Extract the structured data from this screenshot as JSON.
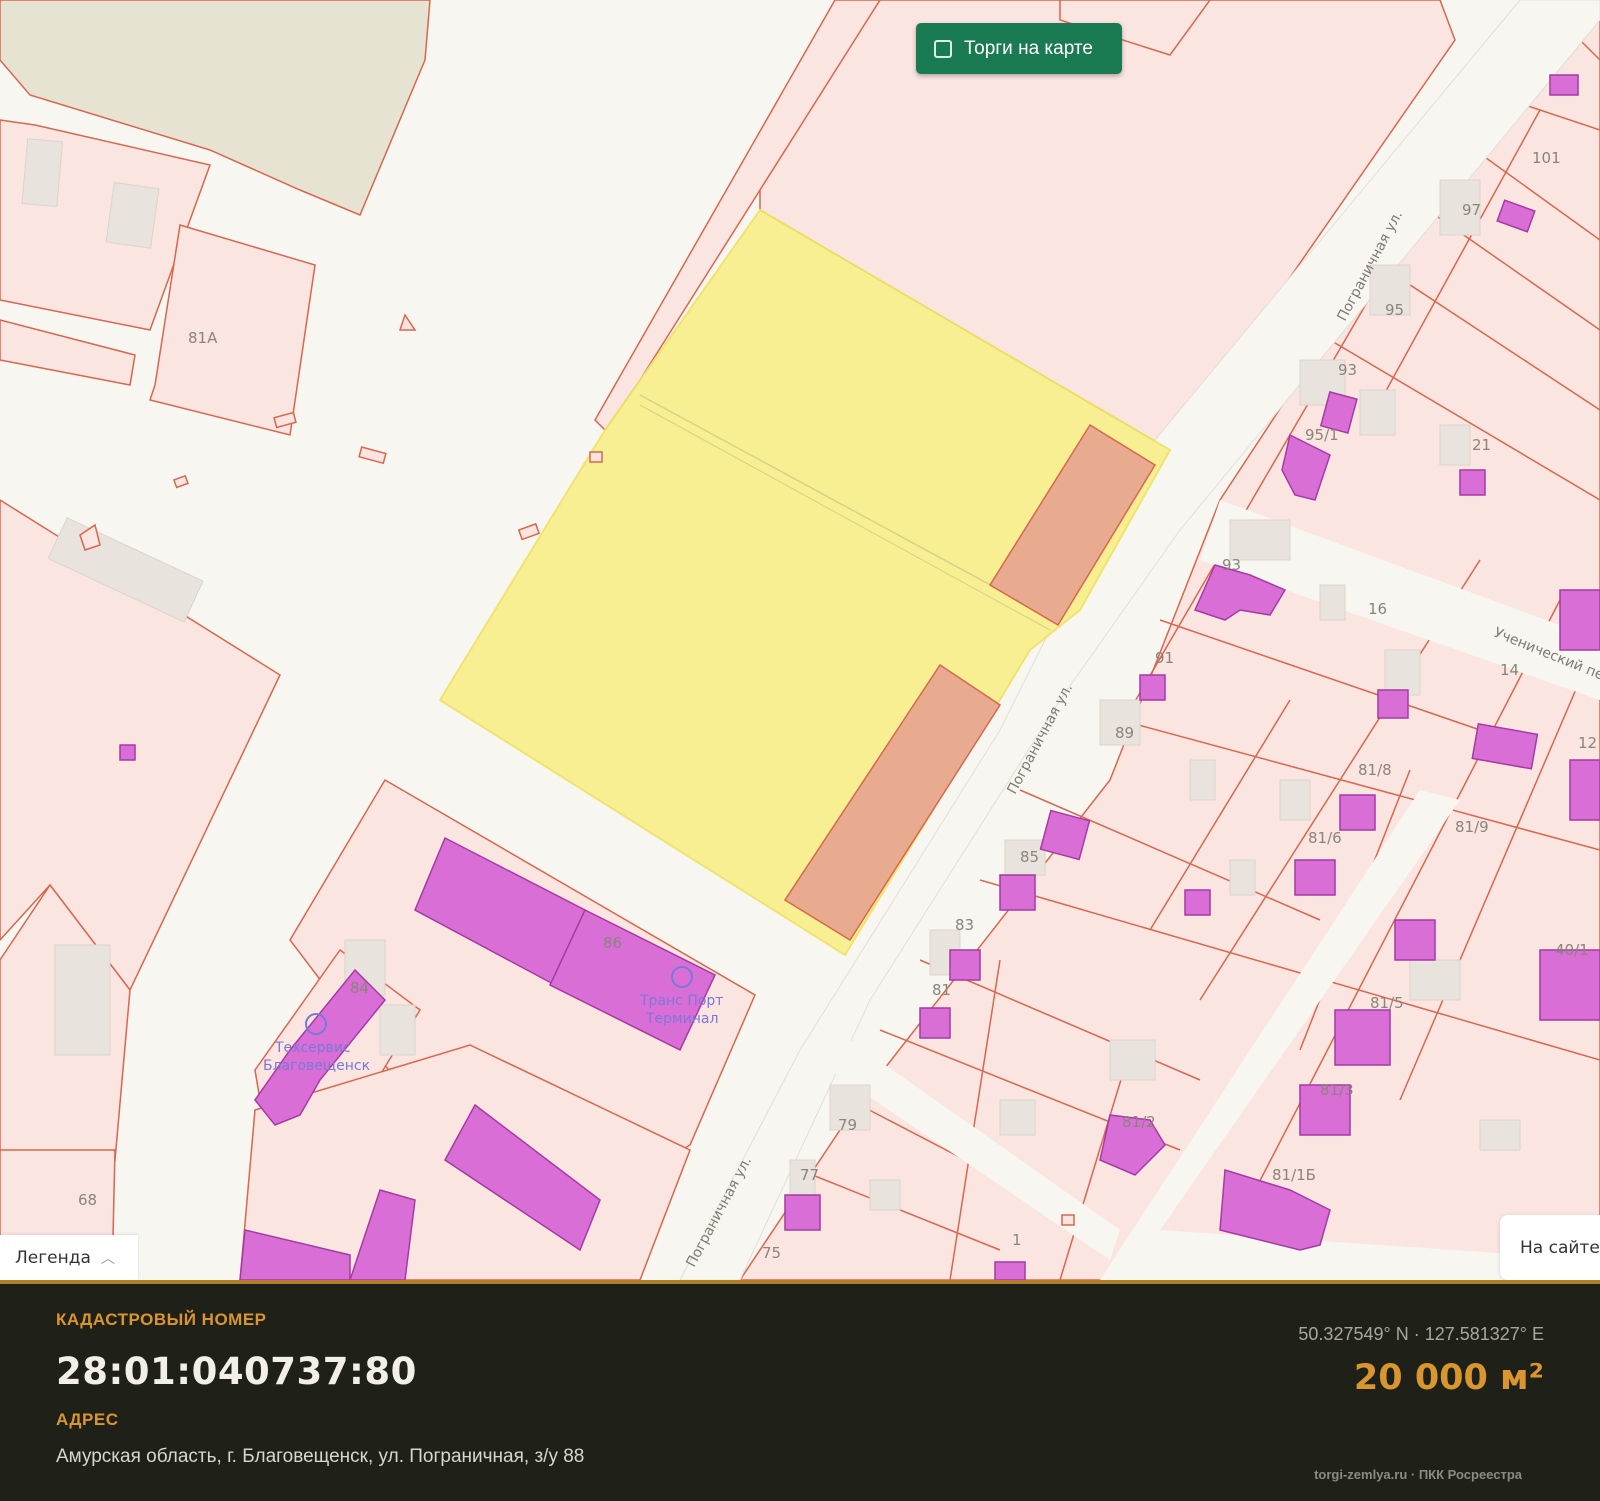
{
  "map": {
    "torgi_button": "Торги на карте",
    "legend_button": "Легенда",
    "onsite_button": "На сайте",
    "parcel_labels": [
      "81А",
      "101",
      "97",
      "95",
      "93",
      "95/1",
      "21",
      "16",
      "14",
      "12",
      "93",
      "91",
      "89",
      "81/8",
      "81/9",
      "81/6",
      "85",
      "83",
      "81",
      "81/5",
      "40/1",
      "81/3",
      "81/2",
      "81/1Б",
      "79",
      "77",
      "75",
      "68",
      "86",
      "84",
      "1"
    ],
    "street_labels": [
      "Пограничная ул.",
      "Пограничная ул.",
      "Пограничная ул.",
      "Ученический пер."
    ],
    "poi": [
      {
        "name_line1": "Транс Порт",
        "name_line2": "Терминал"
      },
      {
        "name_line1": "Техсервис",
        "name_line2": "Благовещенск"
      }
    ],
    "colors": {
      "parcel": "#fbe5e1",
      "parcel_stroke": "#d9664d",
      "building": "#d96fd6",
      "selected": "#f7ef8c",
      "road": "#f8f6f1"
    }
  },
  "info": {
    "cadastral_heading": "КАДАСТРОВЫЙ НОМЕР",
    "cadastral_number": "28:01:040737:80",
    "address_heading": "АДРЕС",
    "address": "Амурская область, г. Благовещенск, ул. Пограничная, з/у 88",
    "coordinates": "50.327549° N · 127.581327° E",
    "area": "20 000 м²",
    "source": "torgi-zemlya.ru · ПКК Росреестра",
    "accent_color": "#d9962e"
  }
}
